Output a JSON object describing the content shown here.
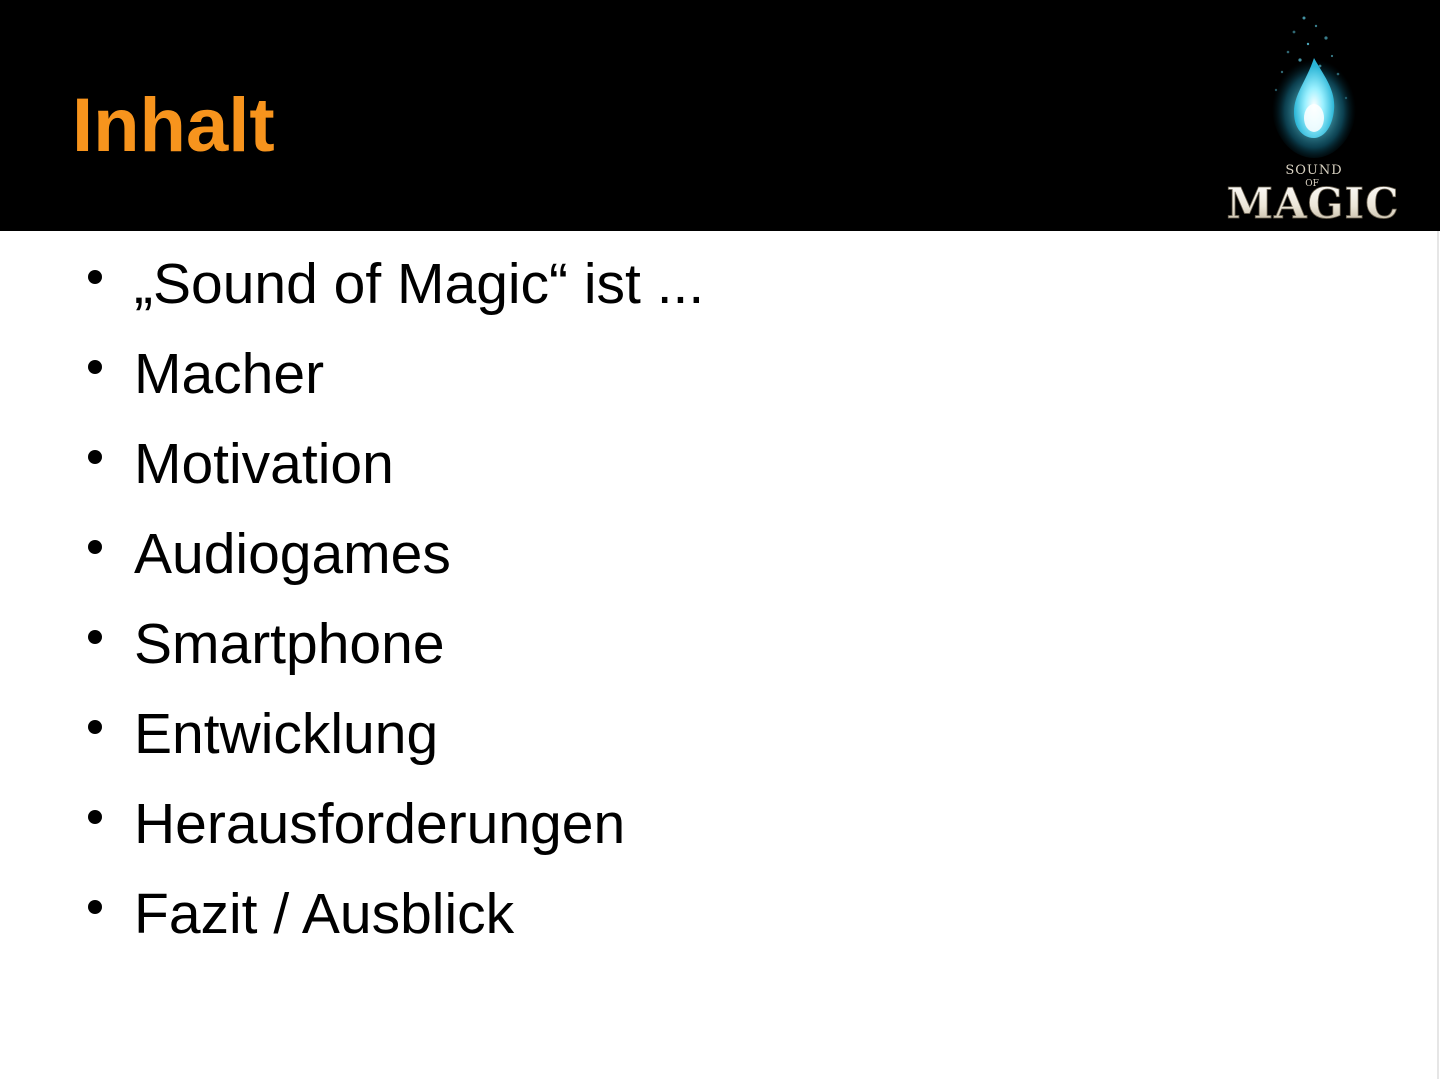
{
  "slide": {
    "title": "Inhalt",
    "title_color": "#f7941d",
    "header_color": "#000000",
    "logo": {
      "text_small": "SOUND",
      "text_of": "OF",
      "text_main": "MAGIC",
      "icon": "blue-flame-icon"
    },
    "bullets": [
      "„Sound of Magic“ ist ...",
      "Macher",
      "Motivation",
      "Audiogames",
      "Smartphone",
      "Entwicklung",
      "Herausforderungen",
      "Fazit / Ausblick"
    ]
  }
}
